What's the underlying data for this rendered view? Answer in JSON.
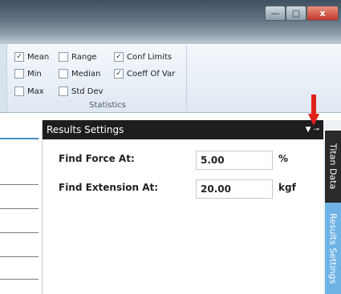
{
  "window": {
    "min_glyph": "—",
    "max_glyph": "▢",
    "close_glyph": "x"
  },
  "statistics": {
    "group_label": "Statistics",
    "options": [
      {
        "label": "Mean",
        "checked": true
      },
      {
        "label": "Range",
        "checked": false
      },
      {
        "label": "Conf Limits",
        "checked": true
      },
      {
        "label": "Min",
        "checked": false
      },
      {
        "label": "Median",
        "checked": false
      },
      {
        "label": "Coeff Of Var",
        "checked": true
      },
      {
        "label": "Max",
        "checked": false
      },
      {
        "label": "Std Dev",
        "checked": false
      }
    ]
  },
  "results_settings": {
    "title": "Results Settings",
    "icons": "▼ ⊸",
    "rows": [
      {
        "label": "Find Force At:",
        "value": "5.00",
        "unit": "%"
      },
      {
        "label": "Find Extension At:",
        "value": "20.00",
        "unit": "kgf"
      }
    ]
  },
  "side_tabs": {
    "titan": "Titan Data",
    "results": "Results Settings"
  },
  "colors": {
    "accent": "#4a8ec6",
    "arrow": "#e0201a",
    "active_tab": "#6fb3e6"
  }
}
